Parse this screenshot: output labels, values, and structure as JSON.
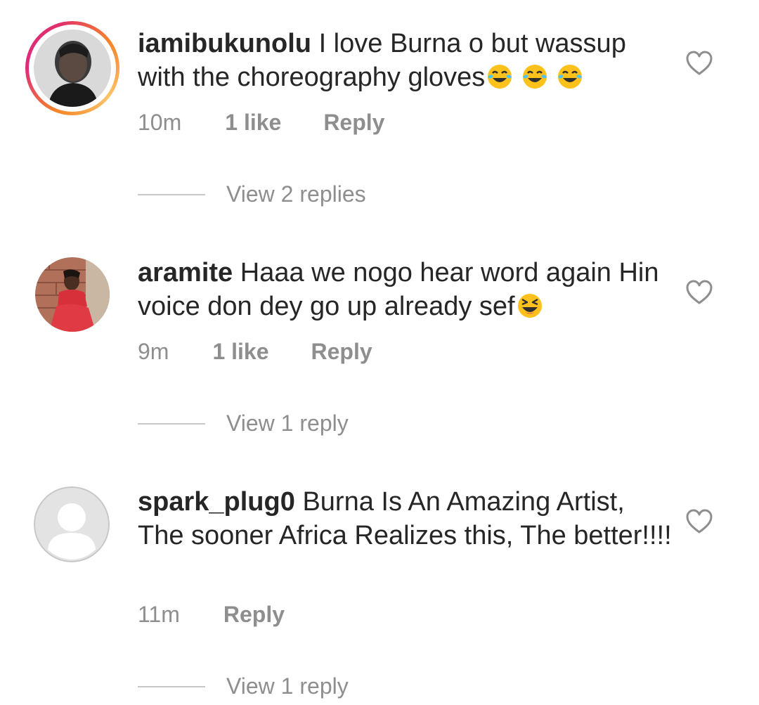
{
  "comments": [
    {
      "username": "iamibukunolu",
      "text": "I love Burna o but wassup with the choreography gloves",
      "emoji": [
        "face-with-tears-of-joy",
        "face-with-tears-of-joy",
        "face-with-tears-of-joy"
      ],
      "time": "10m",
      "likes": "1 like",
      "reply_label": "Reply",
      "view_replies": "View 2 replies",
      "has_story_ring": true
    },
    {
      "username": "aramite",
      "text": "Haaa we nogo hear word again Hin voice don dey go up already sef",
      "emoji": [
        "grinning-squinting-face"
      ],
      "time": "9m",
      "likes": "1 like",
      "reply_label": "Reply",
      "view_replies": "View 1 reply",
      "has_story_ring": false
    },
    {
      "username": "spark_plug0",
      "text": "Burna Is An Amazing Artist, The sooner Africa Realizes this, The better!!!!",
      "emoji": [],
      "time": "11m",
      "likes": "",
      "reply_label": "Reply",
      "view_replies": "View 1 reply",
      "has_story_ring": false
    }
  ],
  "colors": {
    "text": "#262626",
    "secondary": "#8e8e8e",
    "divider": "#c7c7c7",
    "heart_outline": "#8e8e8e",
    "story_ring_start": "#f58529",
    "story_ring_end": "#dd2a7b"
  }
}
